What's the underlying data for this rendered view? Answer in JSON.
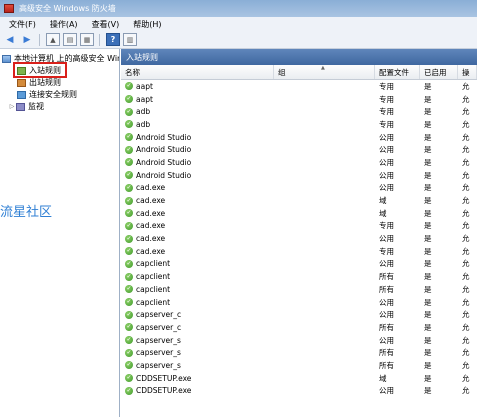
{
  "window": {
    "title": "高级安全 Windows 防火墙"
  },
  "menu": [
    "文件(F)",
    "操作(A)",
    "查看(V)",
    "帮助(H)"
  ],
  "toolbar": {
    "back": "◀",
    "forward": "▶",
    "help": "?"
  },
  "tree": {
    "root": "本地计算机 上的高级安全 Windows",
    "items": [
      "入站规则",
      "出站规则",
      "连接安全规则",
      "监视"
    ]
  },
  "watermark": "流星社区",
  "section_title": "入站规则",
  "columns": {
    "name": "名称",
    "group": "组",
    "profile": "配置文件",
    "enabled": "已启用",
    "op": "操"
  },
  "rows": [
    {
      "name": "aapt",
      "group": "",
      "profile": "专用",
      "enabled": "是",
      "op": "允"
    },
    {
      "name": "aapt",
      "group": "",
      "profile": "专用",
      "enabled": "是",
      "op": "允"
    },
    {
      "name": "adb",
      "group": "",
      "profile": "专用",
      "enabled": "是",
      "op": "允"
    },
    {
      "name": "adb",
      "group": "",
      "profile": "专用",
      "enabled": "是",
      "op": "允"
    },
    {
      "name": "Android Studio",
      "group": "",
      "profile": "公用",
      "enabled": "是",
      "op": "允"
    },
    {
      "name": "Android Studio",
      "group": "",
      "profile": "公用",
      "enabled": "是",
      "op": "允"
    },
    {
      "name": "Android Studio",
      "group": "",
      "profile": "公用",
      "enabled": "是",
      "op": "允"
    },
    {
      "name": "Android Studio",
      "group": "",
      "profile": "公用",
      "enabled": "是",
      "op": "允"
    },
    {
      "name": "cad.exe",
      "group": "",
      "profile": "公用",
      "enabled": "是",
      "op": "允"
    },
    {
      "name": "cad.exe",
      "group": "",
      "profile": "域",
      "enabled": "是",
      "op": "允"
    },
    {
      "name": "cad.exe",
      "group": "",
      "profile": "域",
      "enabled": "是",
      "op": "允"
    },
    {
      "name": "cad.exe",
      "group": "",
      "profile": "专用",
      "enabled": "是",
      "op": "允"
    },
    {
      "name": "cad.exe",
      "group": "",
      "profile": "公用",
      "enabled": "是",
      "op": "允"
    },
    {
      "name": "cad.exe",
      "group": "",
      "profile": "专用",
      "enabled": "是",
      "op": "允"
    },
    {
      "name": "capclient",
      "group": "",
      "profile": "公用",
      "enabled": "是",
      "op": "允"
    },
    {
      "name": "capclient",
      "group": "",
      "profile": "所有",
      "enabled": "是",
      "op": "允"
    },
    {
      "name": "capclient",
      "group": "",
      "profile": "所有",
      "enabled": "是",
      "op": "允"
    },
    {
      "name": "capclient",
      "group": "",
      "profile": "公用",
      "enabled": "是",
      "op": "允"
    },
    {
      "name": "capserver_c",
      "group": "",
      "profile": "公用",
      "enabled": "是",
      "op": "允"
    },
    {
      "name": "capserver_c",
      "group": "",
      "profile": "所有",
      "enabled": "是",
      "op": "允"
    },
    {
      "name": "capserver_s",
      "group": "",
      "profile": "公用",
      "enabled": "是",
      "op": "允"
    },
    {
      "name": "capserver_s",
      "group": "",
      "profile": "所有",
      "enabled": "是",
      "op": "允"
    },
    {
      "name": "capserver_s",
      "group": "",
      "profile": "所有",
      "enabled": "是",
      "op": "允"
    },
    {
      "name": "CDDSETUP.exe",
      "group": "",
      "profile": "域",
      "enabled": "是",
      "op": "允"
    },
    {
      "name": "CDDSETUP.exe",
      "group": "",
      "profile": "公用",
      "enabled": "是",
      "op": "允"
    }
  ]
}
